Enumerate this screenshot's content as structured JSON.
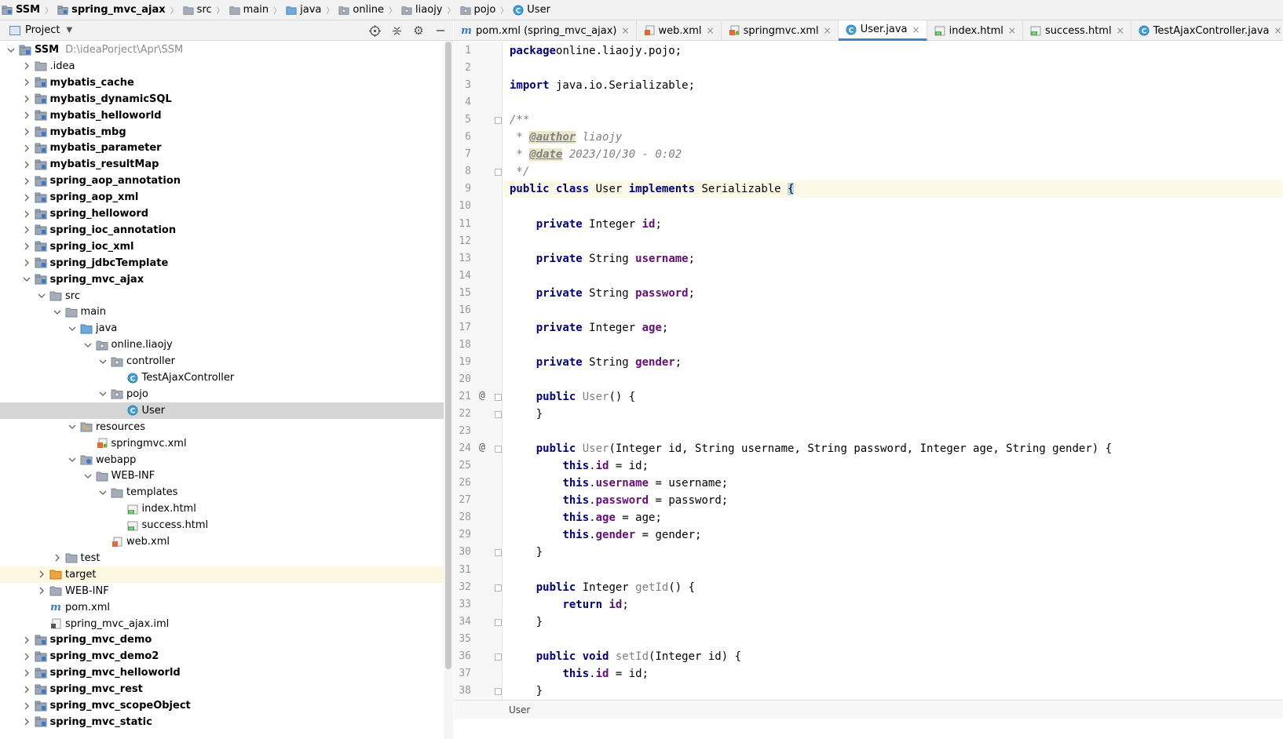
{
  "breadcrumb": [
    {
      "label": "SSM",
      "icon": "module-icon",
      "bold": true
    },
    {
      "label": "spring_mvc_ajax",
      "icon": "module-icon",
      "bold": true
    },
    {
      "label": "src",
      "icon": "folder-icon"
    },
    {
      "label": "main",
      "icon": "folder-icon"
    },
    {
      "label": "java",
      "icon": "source-folder-icon"
    },
    {
      "label": "online",
      "icon": "package-icon"
    },
    {
      "label": "liaojy",
      "icon": "package-icon"
    },
    {
      "label": "pojo",
      "icon": "package-icon"
    },
    {
      "label": "User",
      "icon": "class-icon"
    }
  ],
  "project_panel": {
    "title": "Project",
    "tools": [
      "locate-icon",
      "collapse-all-icon",
      "gear-icon",
      "minimize-icon"
    ]
  },
  "tree": [
    {
      "label": "SSM",
      "path": "D:\\ideaPorject\\Apr\\SSM",
      "depth": 0,
      "arrow": "open",
      "icon": "module",
      "bold": true
    },
    {
      "label": ".idea",
      "depth": 1,
      "arrow": "closed",
      "icon": "folder"
    },
    {
      "label": "mybatis_cache",
      "depth": 1,
      "arrow": "closed",
      "icon": "module",
      "bold": true
    },
    {
      "label": "mybatis_dynamicSQL",
      "depth": 1,
      "arrow": "closed",
      "icon": "module",
      "bold": true
    },
    {
      "label": "mybatis_helloworld",
      "depth": 1,
      "arrow": "closed",
      "icon": "module",
      "bold": true
    },
    {
      "label": "mybatis_mbg",
      "depth": 1,
      "arrow": "closed",
      "icon": "module",
      "bold": true
    },
    {
      "label": "mybatis_parameter",
      "depth": 1,
      "arrow": "closed",
      "icon": "module",
      "bold": true
    },
    {
      "label": "mybatis_resultMap",
      "depth": 1,
      "arrow": "closed",
      "icon": "module",
      "bold": true
    },
    {
      "label": "spring_aop_annotation",
      "depth": 1,
      "arrow": "closed",
      "icon": "module",
      "bold": true
    },
    {
      "label": "spring_aop_xml",
      "depth": 1,
      "arrow": "closed",
      "icon": "module",
      "bold": true
    },
    {
      "label": "spring_helloword",
      "depth": 1,
      "arrow": "closed",
      "icon": "module",
      "bold": true
    },
    {
      "label": "spring_ioc_annotation",
      "depth": 1,
      "arrow": "closed",
      "icon": "module",
      "bold": true
    },
    {
      "label": "spring_ioc_xml",
      "depth": 1,
      "arrow": "closed",
      "icon": "module",
      "bold": true
    },
    {
      "label": "spring_jdbcTemplate",
      "depth": 1,
      "arrow": "closed",
      "icon": "module",
      "bold": true
    },
    {
      "label": "spring_mvc_ajax",
      "depth": 1,
      "arrow": "open",
      "icon": "module",
      "bold": true
    },
    {
      "label": "src",
      "depth": 2,
      "arrow": "open",
      "icon": "folder"
    },
    {
      "label": "main",
      "depth": 3,
      "arrow": "open",
      "icon": "folder"
    },
    {
      "label": "java",
      "depth": 4,
      "arrow": "open",
      "icon": "srcfolder"
    },
    {
      "label": "online.liaojy",
      "depth": 5,
      "arrow": "open",
      "icon": "package"
    },
    {
      "label": "controller",
      "depth": 6,
      "arrow": "open",
      "icon": "package"
    },
    {
      "label": "TestAjaxController",
      "depth": 7,
      "arrow": "none",
      "icon": "class"
    },
    {
      "label": "pojo",
      "depth": 6,
      "arrow": "open",
      "icon": "package"
    },
    {
      "label": "User",
      "depth": 7,
      "arrow": "none",
      "icon": "class",
      "selected": true
    },
    {
      "label": "resources",
      "depth": 4,
      "arrow": "open",
      "icon": "resfolder"
    },
    {
      "label": "springmvc.xml",
      "depth": 5,
      "arrow": "none",
      "icon": "springxml"
    },
    {
      "label": "webapp",
      "depth": 4,
      "arrow": "open",
      "icon": "webfolder"
    },
    {
      "label": "WEB-INF",
      "depth": 5,
      "arrow": "open",
      "icon": "folder"
    },
    {
      "label": "templates",
      "depth": 6,
      "arrow": "open",
      "icon": "folder"
    },
    {
      "label": "index.html",
      "depth": 7,
      "arrow": "none",
      "icon": "html"
    },
    {
      "label": "success.html",
      "depth": 7,
      "arrow": "none",
      "icon": "html"
    },
    {
      "label": "web.xml",
      "depth": 6,
      "arrow": "none",
      "icon": "webxml"
    },
    {
      "label": "test",
      "depth": 3,
      "arrow": "closed",
      "icon": "folder"
    },
    {
      "label": "target",
      "depth": 2,
      "arrow": "closed",
      "icon": "orangefolder",
      "highlight": true
    },
    {
      "label": "WEB-INF",
      "depth": 2,
      "arrow": "closed",
      "icon": "folder"
    },
    {
      "label": "pom.xml",
      "depth": 2,
      "arrow": "none",
      "icon": "maven"
    },
    {
      "label": "spring_mvc_ajax.iml",
      "depth": 2,
      "arrow": "none",
      "icon": "iml"
    },
    {
      "label": "spring_mvc_demo",
      "depth": 1,
      "arrow": "closed",
      "icon": "module",
      "bold": true
    },
    {
      "label": "spring_mvc_demo2",
      "depth": 1,
      "arrow": "closed",
      "icon": "module",
      "bold": true
    },
    {
      "label": "spring_mvc_helloworld",
      "depth": 1,
      "arrow": "closed",
      "icon": "module",
      "bold": true
    },
    {
      "label": "spring_mvc_rest",
      "depth": 1,
      "arrow": "closed",
      "icon": "module",
      "bold": true
    },
    {
      "label": "spring_mvc_scopeObject",
      "depth": 1,
      "arrow": "closed",
      "icon": "module",
      "bold": true
    },
    {
      "label": "spring_mvc_static",
      "depth": 1,
      "arrow": "closed",
      "icon": "module",
      "bold": true
    }
  ],
  "tabs": [
    {
      "label": "pom.xml (spring_mvc_ajax)",
      "icon": "maven"
    },
    {
      "label": "web.xml",
      "icon": "webxml"
    },
    {
      "label": "springmvc.xml",
      "icon": "springxml"
    },
    {
      "label": "User.java",
      "icon": "class",
      "active": true
    },
    {
      "label": "index.html",
      "icon": "html"
    },
    {
      "label": "success.html",
      "icon": "html"
    },
    {
      "label": "TestAjaxController.java",
      "icon": "class"
    }
  ],
  "tab_close_glyph": "×",
  "code_lines": [
    [
      [
        "kw",
        "package"
      ],
      [
        "",
        "online.liaojy.pojo;"
      ]
    ],
    [],
    [
      [
        "kw",
        "import"
      ],
      [
        "",
        " java.io.Serializable;"
      ]
    ],
    [],
    [
      [
        "cmt",
        "/**"
      ]
    ],
    [
      [
        "cmt",
        " * "
      ],
      [
        "tag",
        "@author"
      ],
      [
        "cmt",
        " liaojy"
      ]
    ],
    [
      [
        "cmt",
        " * "
      ],
      [
        "tag",
        "@date"
      ],
      [
        "cmt",
        " 2023/10/30 - 0:02"
      ]
    ],
    [
      [
        "cmt",
        " */"
      ]
    ],
    [
      [
        "kw",
        "public class"
      ],
      [
        "",
        " User "
      ],
      [
        "kw",
        "implements"
      ],
      [
        "",
        " Serializable "
      ],
      [
        "brace",
        "{"
      ]
    ],
    [],
    [
      [
        "",
        "    "
      ],
      [
        "kw",
        "private"
      ],
      [
        "",
        " Integer "
      ],
      [
        "fld",
        "id"
      ],
      [
        "",
        ";"
      ]
    ],
    [],
    [
      [
        "",
        "    "
      ],
      [
        "kw",
        "private"
      ],
      [
        "",
        " String "
      ],
      [
        "fld",
        "username"
      ],
      [
        "",
        ";"
      ]
    ],
    [],
    [
      [
        "",
        "    "
      ],
      [
        "kw",
        "private"
      ],
      [
        "",
        " String "
      ],
      [
        "fld",
        "password"
      ],
      [
        "",
        ";"
      ]
    ],
    [],
    [
      [
        "",
        "    "
      ],
      [
        "kw",
        "private"
      ],
      [
        "",
        " Integer "
      ],
      [
        "fld",
        "age"
      ],
      [
        "",
        ";"
      ]
    ],
    [],
    [
      [
        "",
        "    "
      ],
      [
        "kw",
        "private"
      ],
      [
        "",
        " String "
      ],
      [
        "fld",
        "gender"
      ],
      [
        "",
        ";"
      ]
    ],
    [],
    [
      [
        "",
        "    "
      ],
      [
        "kw",
        "public"
      ],
      [
        "mdecl",
        " User"
      ],
      [
        "",
        "() {"
      ]
    ],
    [
      [
        "",
        "    }"
      ]
    ],
    [],
    [
      [
        "",
        "    "
      ],
      [
        "kw",
        "public"
      ],
      [
        "mdecl",
        " User"
      ],
      [
        "",
        "(Integer id, String username, String password, Integer age, String gender) {"
      ]
    ],
    [
      [
        "",
        "        "
      ],
      [
        "kw",
        "this"
      ],
      [
        "",
        "."
      ],
      [
        "fld",
        "id"
      ],
      [
        "",
        " = id;"
      ]
    ],
    [
      [
        "",
        "        "
      ],
      [
        "kw",
        "this"
      ],
      [
        "",
        "."
      ],
      [
        "fld",
        "username"
      ],
      [
        "",
        " = username;"
      ]
    ],
    [
      [
        "",
        "        "
      ],
      [
        "kw",
        "this"
      ],
      [
        "",
        "."
      ],
      [
        "fld",
        "password"
      ],
      [
        "",
        " = password;"
      ]
    ],
    [
      [
        "",
        "        "
      ],
      [
        "kw",
        "this"
      ],
      [
        "",
        "."
      ],
      [
        "fld",
        "age"
      ],
      [
        "",
        " = age;"
      ]
    ],
    [
      [
        "",
        "        "
      ],
      [
        "kw",
        "this"
      ],
      [
        "",
        "."
      ],
      [
        "fld",
        "gender"
      ],
      [
        "",
        " = gender;"
      ]
    ],
    [
      [
        "",
        "    }"
      ]
    ],
    [],
    [
      [
        "",
        "    "
      ],
      [
        "kw",
        "public"
      ],
      [
        "",
        " Integer "
      ],
      [
        "mdecl",
        "getId"
      ],
      [
        "",
        "() {"
      ]
    ],
    [
      [
        "",
        "        "
      ],
      [
        "kw",
        "return"
      ],
      [
        "",
        " "
      ],
      [
        "fld",
        "id"
      ],
      [
        "",
        ";"
      ]
    ],
    [
      [
        "",
        "    }"
      ]
    ],
    [],
    [
      [
        "",
        "    "
      ],
      [
        "kw",
        "public void"
      ],
      [
        "mdecl",
        " setId"
      ],
      [
        "",
        "(Integer id) {"
      ]
    ],
    [
      [
        "",
        "        "
      ],
      [
        "kw",
        "this"
      ],
      [
        "",
        "."
      ],
      [
        "fld",
        "id"
      ],
      [
        "",
        " = id;"
      ]
    ],
    [
      [
        "",
        "    }"
      ]
    ]
  ],
  "current_line": 9,
  "gutter_marks": [
    {
      "line": 21,
      "glyph": "@"
    },
    {
      "line": 24,
      "glyph": "@"
    }
  ],
  "fold_lines": [
    5,
    8,
    21,
    22,
    24,
    30,
    32,
    34,
    36,
    38
  ],
  "status": {
    "context": "User"
  }
}
